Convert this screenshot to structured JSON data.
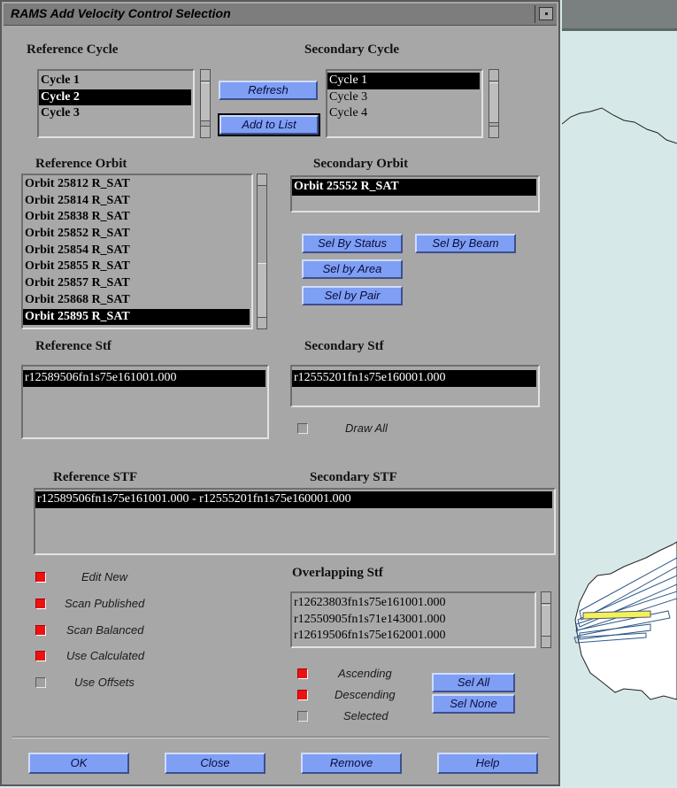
{
  "window": {
    "title": "RAMS Add Velocity Control Selection"
  },
  "reference_cycle": {
    "label": "Reference Cycle",
    "items": [
      "Cycle 1",
      "Cycle 2",
      "Cycle 3"
    ],
    "selected": "Cycle 2"
  },
  "secondary_cycle": {
    "label": "Secondary Cycle",
    "items": [
      "Cycle 1",
      "Cycle 3",
      "Cycle 4"
    ],
    "selected": "Cycle 1"
  },
  "buttons": {
    "refresh": "Refresh",
    "add_to_list": "Add to List",
    "sel_by_status": "Sel By Status",
    "sel_by_beam": "Sel By Beam",
    "sel_by_area": "Sel by Area",
    "sel_by_pair": "Sel by Pair",
    "sel_all": "Sel All",
    "sel_none": "Sel None",
    "ok": "OK",
    "close": "Close",
    "remove": "Remove",
    "help": "Help"
  },
  "reference_orbit": {
    "label": "Reference Orbit",
    "items": [
      "Orbit 25812 R_SAT",
      "Orbit 25814 R_SAT",
      "Orbit 25838 R_SAT",
      "Orbit 25852 R_SAT",
      "Orbit 25854 R_SAT",
      "Orbit 25855 R_SAT",
      "Orbit 25857 R_SAT",
      "Orbit 25868 R_SAT",
      "Orbit 25895 R_SAT"
    ],
    "selected": "Orbit 25895 R_SAT"
  },
  "secondary_orbit": {
    "label": "Secondary Orbit",
    "items": [
      "Orbit 25552 R_SAT"
    ],
    "selected": "Orbit 25552 R_SAT"
  },
  "reference_stf": {
    "label": "Reference Stf",
    "items": [
      "r12589506fn1s75e161001.000"
    ]
  },
  "secondary_stf": {
    "label": "Secondary Stf",
    "items": [
      "r12555201fn1s75e160001.000"
    ],
    "draw_all": {
      "label": "Draw All",
      "checked": false
    }
  },
  "pair_list": {
    "ref_label": "Reference STF",
    "sec_label": "Secondary STF",
    "items": [
      "r12589506fn1s75e161001.000 - r12555201fn1s75e160001.000"
    ]
  },
  "options": [
    {
      "label": "Edit New",
      "checked": true
    },
    {
      "label": "Scan Published",
      "checked": true
    },
    {
      "label": "Scan Balanced",
      "checked": true
    },
    {
      "label": "Use Calculated",
      "checked": true
    },
    {
      "label": "Use Offsets",
      "checked": false
    }
  ],
  "overlapping_stf": {
    "label": "Overlapping Stf",
    "items": [
      "r12623803fn1s75e161001.000",
      "r12550905fn1s71e143001.000",
      "r12619506fn1s75e162001.000"
    ]
  },
  "direction": [
    {
      "label": "Ascending",
      "checked": true
    },
    {
      "label": "Descending",
      "checked": true
    },
    {
      "label": "Selected",
      "checked": false
    }
  ],
  "colors": {
    "button": "#7f9ff5",
    "panel": "#a7a7a7",
    "checked": "#ee1111",
    "selection": "#000000"
  }
}
